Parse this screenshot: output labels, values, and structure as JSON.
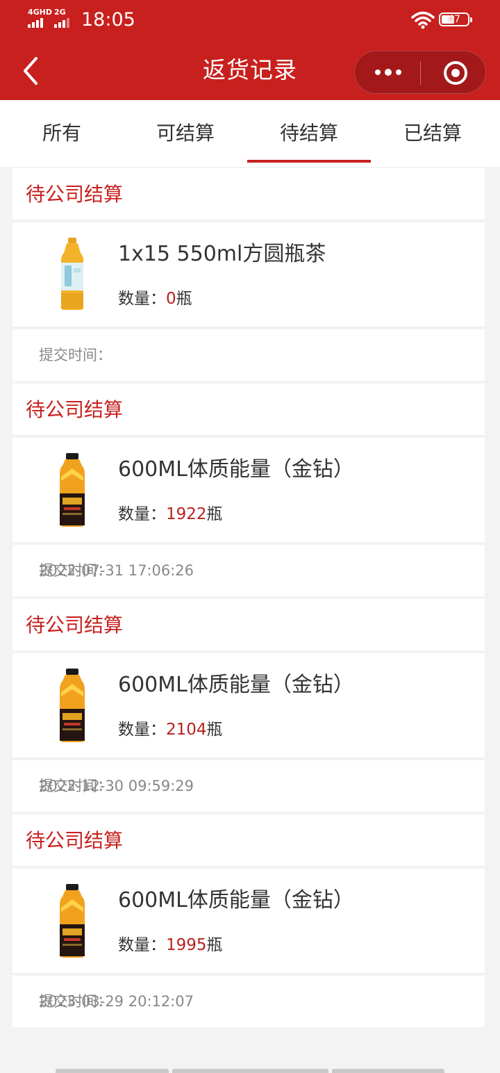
{
  "status_bar": {
    "signal1_label": "4GHD",
    "signal2_label": "2G",
    "time": "18:05",
    "battery": "47"
  },
  "header": {
    "title": "返货记录"
  },
  "tabs": [
    {
      "label": "所有",
      "active": false
    },
    {
      "label": "可结算",
      "active": false
    },
    {
      "label": "待结算",
      "active": true
    },
    {
      "label": "已结算",
      "active": false
    }
  ],
  "records": [
    {
      "status": "待公司结算",
      "product_name": "1x15 550ml方圆瓶茶",
      "qty_label": "数量：",
      "qty_value": "0",
      "qty_unit": "瓶",
      "submit_label": "提交时间：",
      "submit_time": ""
    },
    {
      "status": "待公司结算",
      "product_name": "600ML体质能量（金钻）",
      "qty_label": "数量：",
      "qty_value": "1922",
      "qty_unit": "瓶",
      "submit_label": "提交时间：",
      "submit_time": "2022-07-31 17:06:26"
    },
    {
      "status": "待公司结算",
      "product_name": "600ML体质能量（金钻）",
      "qty_label": "数量：",
      "qty_value": "2104",
      "qty_unit": "瓶",
      "submit_label": "提交时间：",
      "submit_time": "2022-12-30 09:59:29"
    },
    {
      "status": "待公司结算",
      "product_name": "600ML体质能量（金钻）",
      "qty_label": "数量：",
      "qty_value": "1995",
      "qty_unit": "瓶",
      "submit_label": "提交时间：",
      "submit_time": "2023-03-29 20:12:07"
    }
  ],
  "colors": {
    "brand": "#c8201e",
    "quantity": "#b8201e"
  },
  "icons": [
    "back-arrow-icon",
    "more-dots-icon",
    "close-target-icon",
    "wifi-icon",
    "battery-icon"
  ]
}
